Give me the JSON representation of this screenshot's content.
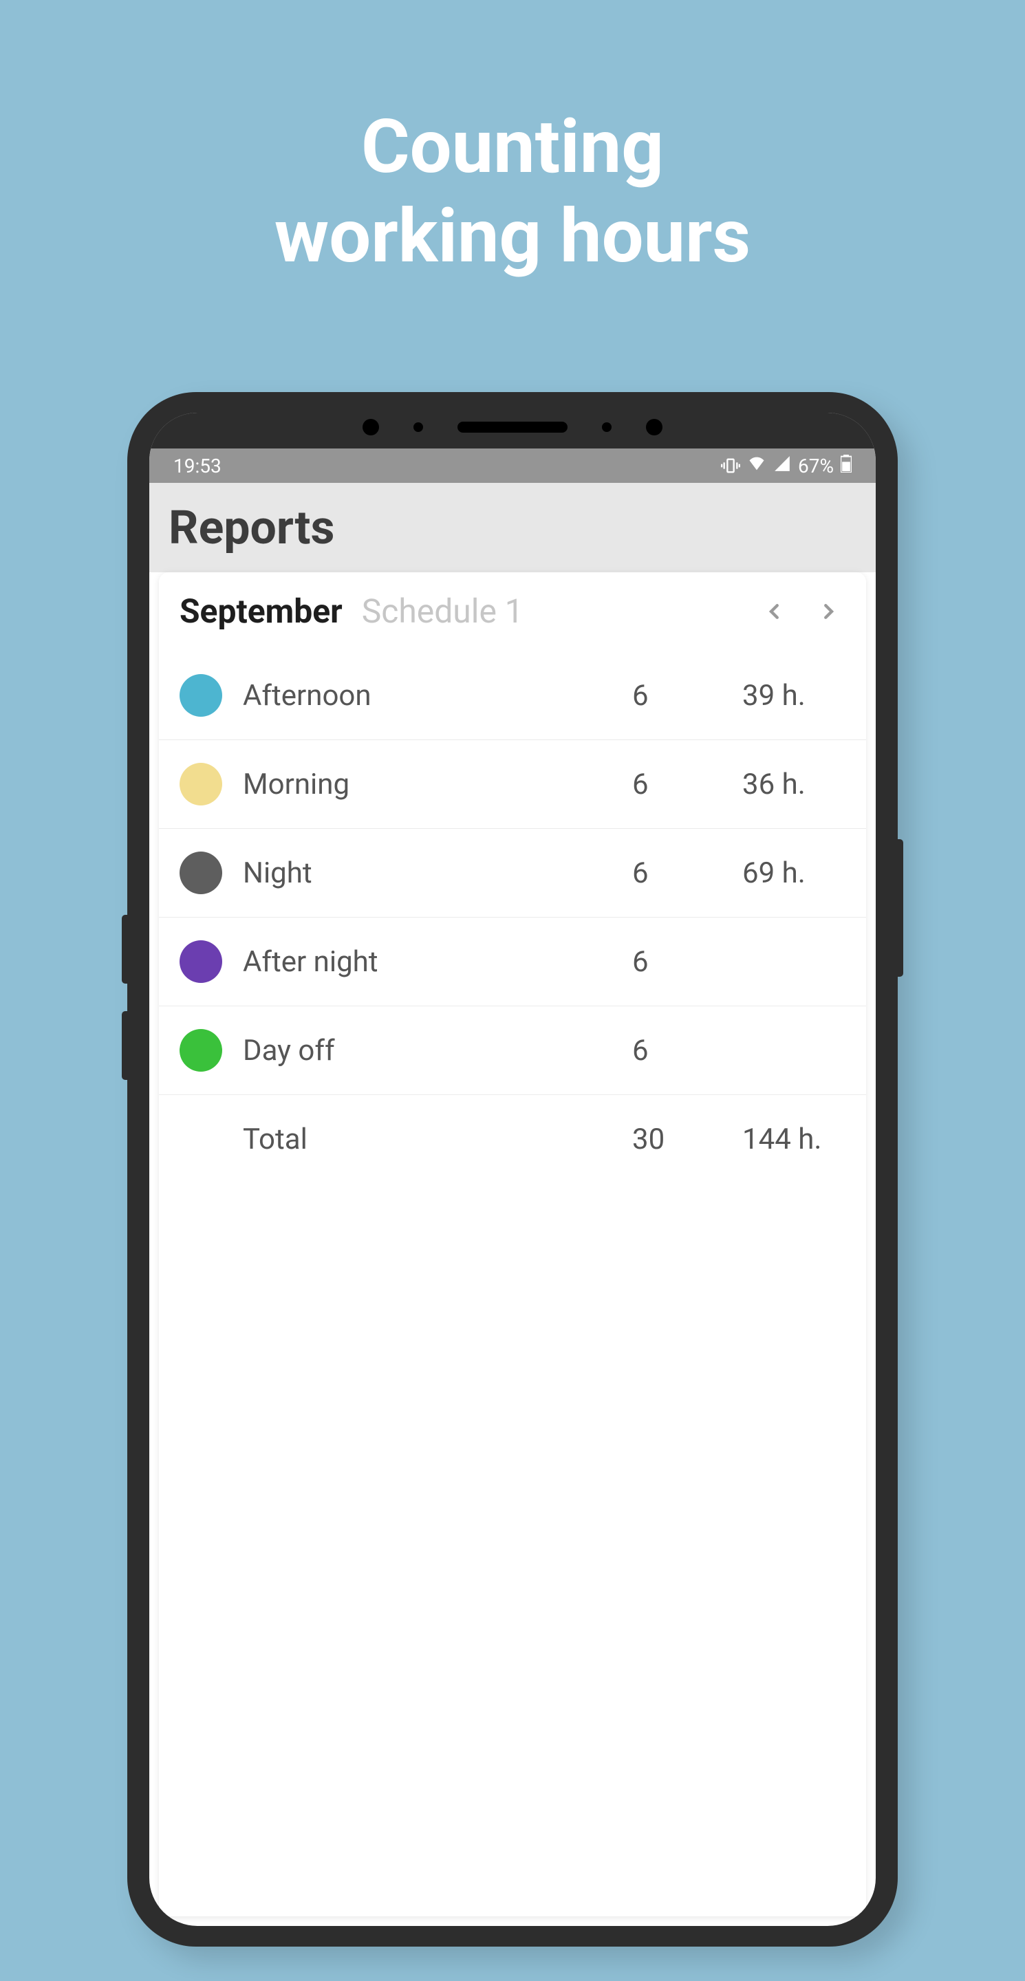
{
  "marketing": {
    "headline_line1": "Counting",
    "headline_line2": "working hours"
  },
  "status_bar": {
    "time": "19:53",
    "battery_pct": "67%"
  },
  "header": {
    "title": "Reports"
  },
  "card": {
    "month": "September",
    "schedule": "Schedule 1"
  },
  "rows": [
    {
      "label": "Afternoon",
      "count": "6",
      "hours": "39 h.",
      "color": "#4db5d0"
    },
    {
      "label": "Morning",
      "count": "6",
      "hours": "36 h.",
      "color": "#f2dd8f"
    },
    {
      "label": "Night",
      "count": "6",
      "hours": "69 h.",
      "color": "#5e5e5e"
    },
    {
      "label": "After night",
      "count": "6",
      "hours": "",
      "color": "#6b3eb0"
    },
    {
      "label": "Day off",
      "count": "6",
      "hours": "",
      "color": "#3ac13b"
    }
  ],
  "total": {
    "label": "Total",
    "count": "30",
    "hours": "144 h."
  }
}
